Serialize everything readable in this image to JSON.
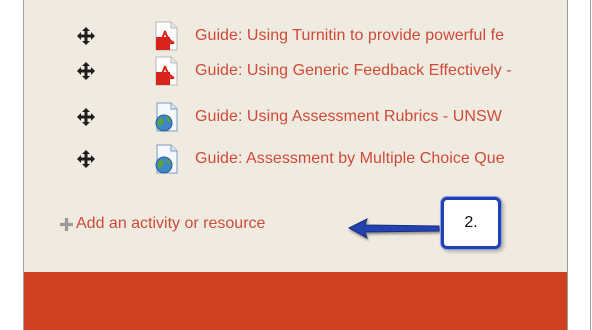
{
  "resources": [
    {
      "label": "Guide: Using Turnitin to provide powerful fe",
      "icon": "pdf-icon"
    },
    {
      "label": "Guide: Using Generic Feedback Effectively -",
      "icon": "pdf-icon"
    },
    {
      "label": "Guide: Using Assessment Rubrics - UNSW",
      "icon": "web-page-icon"
    },
    {
      "label": "Guide: Assessment by Multiple Choice Que",
      "icon": "web-page-icon"
    }
  ],
  "add_activity": {
    "label": "Add an activity or resource",
    "icon": "plus-icon"
  },
  "annotation": {
    "arrow_icon": "arrow-left-icon",
    "callout_label": "2."
  },
  "colors": {
    "link": "#cf4a37",
    "panel_bg": "#f0ebe1",
    "footer": "#cf4020",
    "callout_border": "#2042b0"
  }
}
